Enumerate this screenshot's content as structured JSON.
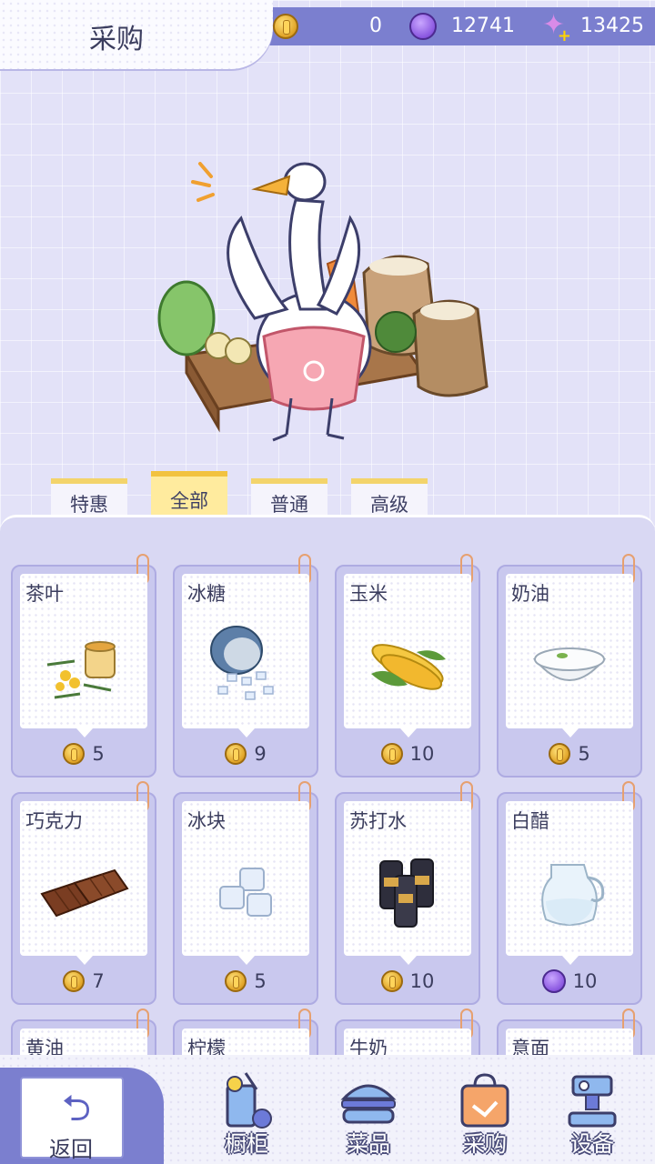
{
  "page_title": "采购",
  "currencies": {
    "gold": "0",
    "gem": "12741",
    "star": "13425"
  },
  "tabs": [
    {
      "label": "特惠",
      "active": false
    },
    {
      "label": "全部",
      "active": true
    },
    {
      "label": "普通",
      "active": false
    },
    {
      "label": "高级",
      "active": false
    }
  ],
  "items": [
    {
      "name": "茶叶",
      "price": "5",
      "currency": "gold",
      "icon": "tea-icon"
    },
    {
      "name": "冰糖",
      "price": "9",
      "currency": "gold",
      "icon": "rock-sugar-icon"
    },
    {
      "name": "玉米",
      "price": "10",
      "currency": "gold",
      "icon": "corn-icon"
    },
    {
      "name": "奶油",
      "price": "5",
      "currency": "gold",
      "icon": "cream-icon"
    },
    {
      "name": "巧克力",
      "price": "7",
      "currency": "gold",
      "icon": "chocolate-icon"
    },
    {
      "name": "冰块",
      "price": "5",
      "currency": "gold",
      "icon": "ice-cubes-icon"
    },
    {
      "name": "苏打水",
      "price": "10",
      "currency": "gold",
      "icon": "soda-icon"
    },
    {
      "name": "白醋",
      "price": "10",
      "currency": "gem",
      "icon": "vinegar-icon"
    },
    {
      "name": "黄油",
      "icon": "butter-icon"
    },
    {
      "name": "柠檬",
      "icon": "lemon-icon"
    },
    {
      "name": "牛奶",
      "icon": "milk-icon"
    },
    {
      "name": "意面",
      "icon": "pasta-icon"
    }
  ],
  "bottom_nav": {
    "back": "返回",
    "items": [
      {
        "label": "橱柜",
        "icon": "cabinet-icon"
      },
      {
        "label": "菜品",
        "icon": "dishes-icon"
      },
      {
        "label": "采购",
        "icon": "purchase-icon"
      },
      {
        "label": "设备",
        "icon": "equipment-icon"
      }
    ]
  }
}
